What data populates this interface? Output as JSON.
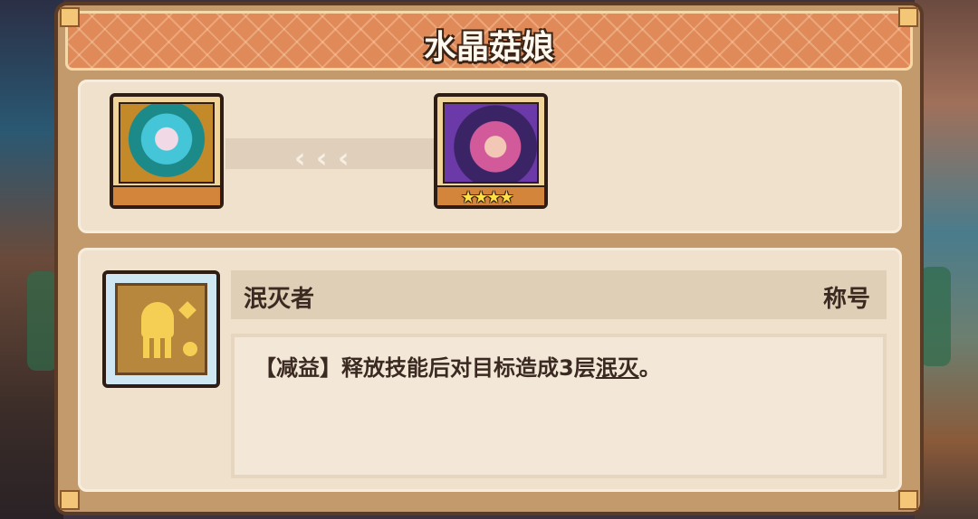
{
  "window": {
    "title": "水晶菇娘"
  },
  "evolution": {
    "from_character": {
      "name": "character-portrait-base"
    },
    "to_character": {
      "stars": "★★★★"
    },
    "arrow_glyph": "‹"
  },
  "skill": {
    "name": "泯灭者",
    "type": "称号",
    "description": {
      "prefix": "【减益】释放技能后对目标造成3层",
      "keyword": "泯灭",
      "suffix": "。"
    }
  },
  "colors": {
    "title_bar": "#e08a5a",
    "panel_bg": "#c39a6c",
    "content_bg": "#efe1cb",
    "text": "#3a2a22"
  }
}
